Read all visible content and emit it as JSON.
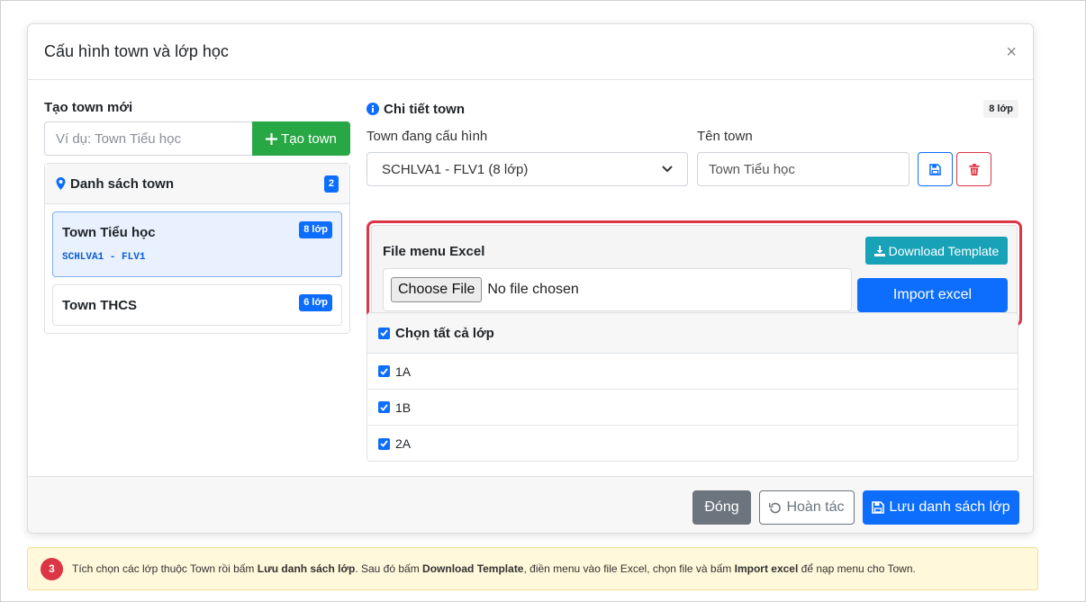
{
  "modal": {
    "title": "Cấu hình town và lớp học",
    "close_glyph": "×"
  },
  "create": {
    "heading": "Tạo town mới",
    "placeholder": "Ví dụ: Town Tiểu học",
    "button_label": "Tạo town"
  },
  "town_list": {
    "title": "Danh sách town",
    "count": "2",
    "items": [
      {
        "name": "Town Tiểu học",
        "code": "SCHLVA1 - FLV1",
        "badge": "8 lớp",
        "active": true
      },
      {
        "name": "Town THCS",
        "code": "",
        "badge": "6 lớp",
        "active": false
      }
    ]
  },
  "detail": {
    "title": "Chi tiết town",
    "badge": "8 lớp",
    "config_label": "Town đang cấu hình",
    "config_selected": "SCHLVA1 - FLV1 (8 lớp)",
    "name_label": "Tên town",
    "name_value": "Town Tiểu học"
  },
  "excel": {
    "title": "File menu Excel",
    "download_label": "Download Template",
    "choose_label": "Choose File",
    "no_file": "No file chosen",
    "import_label": "Import excel"
  },
  "classes": {
    "select_all": "Chọn tất cả lớp",
    "rows": [
      "1A",
      "1B",
      "2A"
    ]
  },
  "footer": {
    "close_label": "Đóng",
    "undo_label": "Hoàn tác",
    "save_label": "Lưu danh sách lớp"
  },
  "hint": {
    "step": "3",
    "p1": "Tích chọn các lớp thuộc Town rồi bấm ",
    "b1": "Lưu danh sách lớp",
    "p2": ". Sau đó bấm ",
    "b2": "Download Template",
    "p3": ", điền menu vào file Excel, chọn file và bấm ",
    "b3": "Import excel",
    "p4": " để nạp menu cho Town."
  },
  "colors": {
    "primary": "#0d6efd",
    "success": "#28a745",
    "danger": "#dc3545",
    "info": "#17a2b8",
    "secondary": "#6c757d"
  }
}
